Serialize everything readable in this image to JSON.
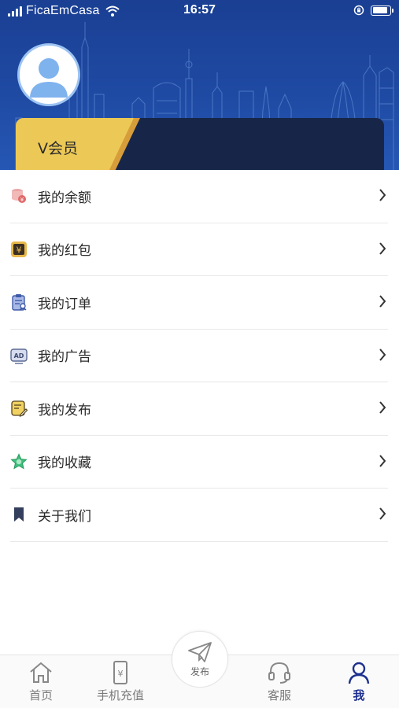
{
  "status_bar": {
    "carrier": "FicaEmCasa",
    "time": "16:57"
  },
  "profile": {
    "vip_label": "V会员"
  },
  "menu": {
    "items": [
      {
        "label": "我的余额",
        "icon": "balance-icon"
      },
      {
        "label": "我的红包",
        "icon": "red-packet-icon"
      },
      {
        "label": "我的订单",
        "icon": "order-icon"
      },
      {
        "label": "我的广告",
        "icon": "ad-icon"
      },
      {
        "label": "我的发布",
        "icon": "publish-record-icon"
      },
      {
        "label": "我的收藏",
        "icon": "favorite-icon"
      },
      {
        "label": "关于我们",
        "icon": "bookmark-icon"
      }
    ]
  },
  "tabbar": {
    "home": "首页",
    "recharge": "手机充值",
    "publish": "发布",
    "service": "客服",
    "me": "我"
  },
  "colors": {
    "header_blue": "#1f4aa3",
    "vip_gold": "#ecc956",
    "vip_dark": "#172648",
    "active_tab": "#1d2f8f"
  }
}
